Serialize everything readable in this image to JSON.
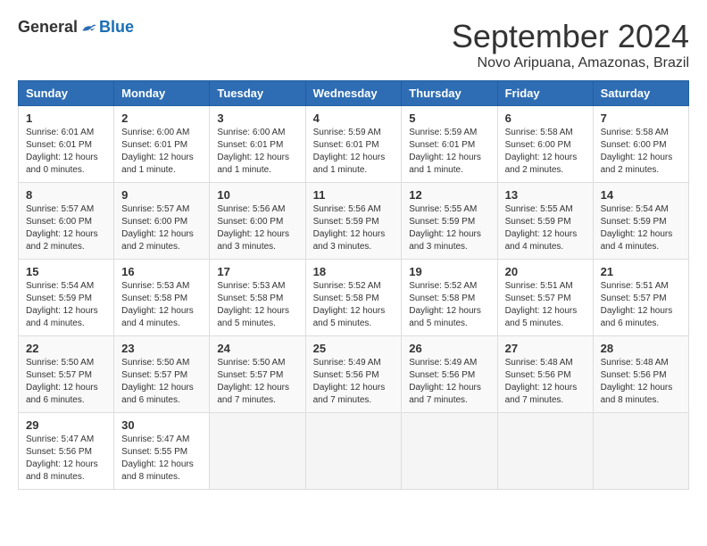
{
  "logo": {
    "general": "General",
    "blue": "Blue"
  },
  "title": "September 2024",
  "subtitle": "Novo Aripuana, Amazonas, Brazil",
  "days_header": [
    "Sunday",
    "Monday",
    "Tuesday",
    "Wednesday",
    "Thursday",
    "Friday",
    "Saturday"
  ],
  "weeks": [
    [
      {
        "day": "1",
        "info": "Sunrise: 6:01 AM\nSunset: 6:01 PM\nDaylight: 12 hours\nand 0 minutes."
      },
      {
        "day": "2",
        "info": "Sunrise: 6:00 AM\nSunset: 6:01 PM\nDaylight: 12 hours\nand 1 minute."
      },
      {
        "day": "3",
        "info": "Sunrise: 6:00 AM\nSunset: 6:01 PM\nDaylight: 12 hours\nand 1 minute."
      },
      {
        "day": "4",
        "info": "Sunrise: 5:59 AM\nSunset: 6:01 PM\nDaylight: 12 hours\nand 1 minute."
      },
      {
        "day": "5",
        "info": "Sunrise: 5:59 AM\nSunset: 6:01 PM\nDaylight: 12 hours\nand 1 minute."
      },
      {
        "day": "6",
        "info": "Sunrise: 5:58 AM\nSunset: 6:00 PM\nDaylight: 12 hours\nand 2 minutes."
      },
      {
        "day": "7",
        "info": "Sunrise: 5:58 AM\nSunset: 6:00 PM\nDaylight: 12 hours\nand 2 minutes."
      }
    ],
    [
      {
        "day": "8",
        "info": "Sunrise: 5:57 AM\nSunset: 6:00 PM\nDaylight: 12 hours\nand 2 minutes."
      },
      {
        "day": "9",
        "info": "Sunrise: 5:57 AM\nSunset: 6:00 PM\nDaylight: 12 hours\nand 2 minutes."
      },
      {
        "day": "10",
        "info": "Sunrise: 5:56 AM\nSunset: 6:00 PM\nDaylight: 12 hours\nand 3 minutes."
      },
      {
        "day": "11",
        "info": "Sunrise: 5:56 AM\nSunset: 5:59 PM\nDaylight: 12 hours\nand 3 minutes."
      },
      {
        "day": "12",
        "info": "Sunrise: 5:55 AM\nSunset: 5:59 PM\nDaylight: 12 hours\nand 3 minutes."
      },
      {
        "day": "13",
        "info": "Sunrise: 5:55 AM\nSunset: 5:59 PM\nDaylight: 12 hours\nand 4 minutes."
      },
      {
        "day": "14",
        "info": "Sunrise: 5:54 AM\nSunset: 5:59 PM\nDaylight: 12 hours\nand 4 minutes."
      }
    ],
    [
      {
        "day": "15",
        "info": "Sunrise: 5:54 AM\nSunset: 5:59 PM\nDaylight: 12 hours\nand 4 minutes."
      },
      {
        "day": "16",
        "info": "Sunrise: 5:53 AM\nSunset: 5:58 PM\nDaylight: 12 hours\nand 4 minutes."
      },
      {
        "day": "17",
        "info": "Sunrise: 5:53 AM\nSunset: 5:58 PM\nDaylight: 12 hours\nand 5 minutes."
      },
      {
        "day": "18",
        "info": "Sunrise: 5:52 AM\nSunset: 5:58 PM\nDaylight: 12 hours\nand 5 minutes."
      },
      {
        "day": "19",
        "info": "Sunrise: 5:52 AM\nSunset: 5:58 PM\nDaylight: 12 hours\nand 5 minutes."
      },
      {
        "day": "20",
        "info": "Sunrise: 5:51 AM\nSunset: 5:57 PM\nDaylight: 12 hours\nand 5 minutes."
      },
      {
        "day": "21",
        "info": "Sunrise: 5:51 AM\nSunset: 5:57 PM\nDaylight: 12 hours\nand 6 minutes."
      }
    ],
    [
      {
        "day": "22",
        "info": "Sunrise: 5:50 AM\nSunset: 5:57 PM\nDaylight: 12 hours\nand 6 minutes."
      },
      {
        "day": "23",
        "info": "Sunrise: 5:50 AM\nSunset: 5:57 PM\nDaylight: 12 hours\nand 6 minutes."
      },
      {
        "day": "24",
        "info": "Sunrise: 5:50 AM\nSunset: 5:57 PM\nDaylight: 12 hours\nand 7 minutes."
      },
      {
        "day": "25",
        "info": "Sunrise: 5:49 AM\nSunset: 5:56 PM\nDaylight: 12 hours\nand 7 minutes."
      },
      {
        "day": "26",
        "info": "Sunrise: 5:49 AM\nSunset: 5:56 PM\nDaylight: 12 hours\nand 7 minutes."
      },
      {
        "day": "27",
        "info": "Sunrise: 5:48 AM\nSunset: 5:56 PM\nDaylight: 12 hours\nand 7 minutes."
      },
      {
        "day": "28",
        "info": "Sunrise: 5:48 AM\nSunset: 5:56 PM\nDaylight: 12 hours\nand 8 minutes."
      }
    ],
    [
      {
        "day": "29",
        "info": "Sunrise: 5:47 AM\nSunset: 5:56 PM\nDaylight: 12 hours\nand 8 minutes."
      },
      {
        "day": "30",
        "info": "Sunrise: 5:47 AM\nSunset: 5:55 PM\nDaylight: 12 hours\nand 8 minutes."
      },
      {
        "day": "",
        "info": ""
      },
      {
        "day": "",
        "info": ""
      },
      {
        "day": "",
        "info": ""
      },
      {
        "day": "",
        "info": ""
      },
      {
        "day": "",
        "info": ""
      }
    ]
  ]
}
